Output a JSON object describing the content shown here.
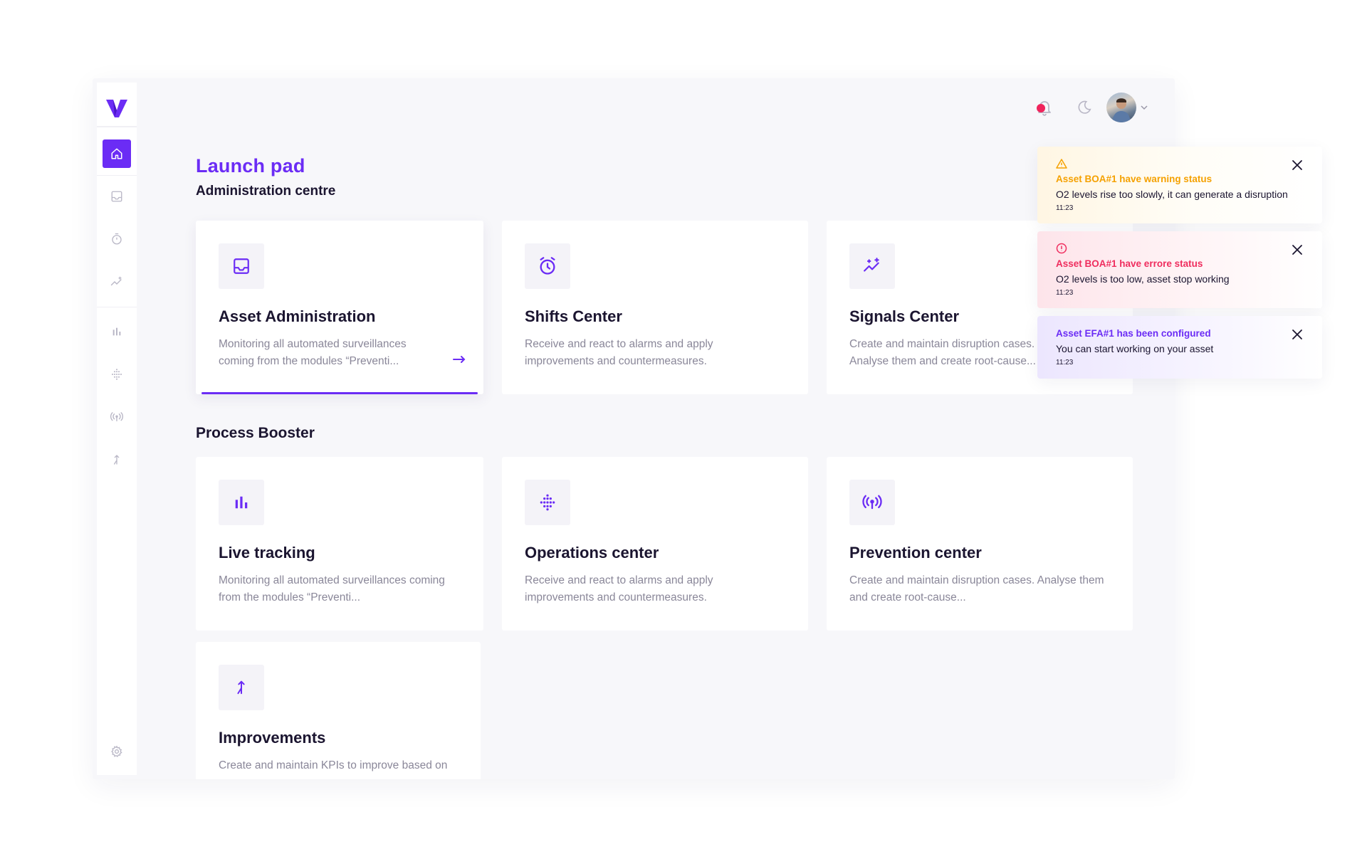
{
  "app": {
    "page_title": "Launch pad",
    "page_subtitle": "Administration centre",
    "section_title": "Process Booster"
  },
  "sidebar": {
    "items": [
      {
        "name": "home",
        "icon": "home-icon",
        "active": true
      },
      {
        "name": "inbox",
        "icon": "inbox-icon"
      },
      {
        "name": "timer",
        "icon": "stopwatch-icon"
      },
      {
        "name": "signals",
        "icon": "sparkle-trend-icon"
      },
      {
        "name": "live-tracking",
        "icon": "bar-chart-icon"
      },
      {
        "name": "operations",
        "icon": "dot-grid-icon"
      },
      {
        "name": "prevention",
        "icon": "broadcast-icon"
      },
      {
        "name": "improvements",
        "icon": "merge-arrow-icon"
      },
      {
        "name": "settings",
        "icon": "gear-icon"
      }
    ]
  },
  "header": {
    "notifications_icon": "bell-icon",
    "theme_icon": "moon-icon",
    "avatar_icon": "avatar",
    "menu_icon": "chevron-down-icon"
  },
  "admin_cards": [
    {
      "title": "Asset Administration",
      "desc": "Monitoring all automated surveillances coming from the modules “Preventi...",
      "icon": "inbox-icon"
    },
    {
      "title": "Shifts Center",
      "desc": "Receive and react to alarms and apply improvements and countermeasures.",
      "icon": "alarm-clock-icon"
    },
    {
      "title": "Signals Center",
      "desc": "Create and maintain disruption cases. Analyse them and create root-cause...",
      "icon": "sparkle-trend-icon"
    }
  ],
  "booster_cards": [
    {
      "title": "Live tracking",
      "desc": "Monitoring all automated surveillances coming from the modules “Preventi...",
      "icon": "bar-chart-icon"
    },
    {
      "title": "Operations center",
      "desc": "Receive and react to alarms and apply improvements and countermeasures.",
      "icon": "dot-grid-icon"
    },
    {
      "title": "Prevention center",
      "desc": "Create and maintain disruption cases. Analyse them and create root-cause...",
      "icon": "broadcast-icon"
    },
    {
      "title": "Improvements",
      "desc": "Create and maintain KPIs to improve based on",
      "icon": "merge-arrow-icon"
    }
  ],
  "notifications": [
    {
      "type": "warning",
      "title": "Asset BOA#1 have warning status",
      "body": "O2 levels rise too slowly, it can generate a disruption",
      "time": "11:23",
      "color": "#f5a100",
      "icon": "warning-icon"
    },
    {
      "type": "error",
      "title": "Asset BOA#1 have errore status",
      "body": "O2 levels is too low, asset stop working",
      "time": "11:23",
      "color": "#ef2d5e",
      "icon": "error-icon"
    },
    {
      "type": "info",
      "title": "Asset EFA#1 has been configured",
      "body": "You can start working on your asset",
      "time": "11:23",
      "color": "#6b2cf5"
    }
  ],
  "colors": {
    "accent": "#6b2cf5",
    "warning": "#f5a100",
    "error": "#ef2d5e",
    "text_dark": "#1b1530",
    "text_muted": "#8a8799"
  }
}
